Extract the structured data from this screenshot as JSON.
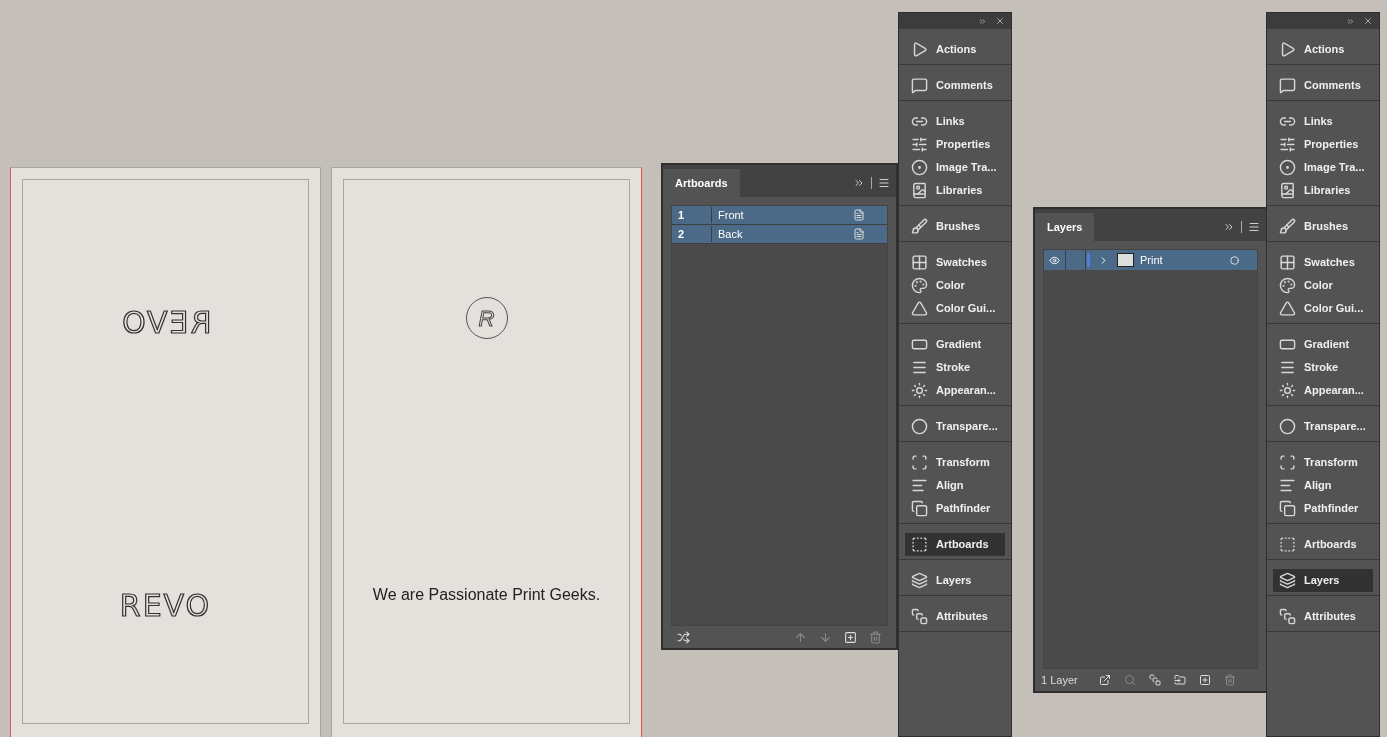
{
  "artboards_canvas": [
    {
      "kind": "logo_mirrored",
      "text": "REVO",
      "text2": "REVO"
    },
    {
      "kind": "tagline",
      "text": "We are Passionate Print Geeks.",
      "logo": "R"
    }
  ],
  "artboards_panel": {
    "tab": "Artboards",
    "rows": [
      {
        "number": "1",
        "name": "Front",
        "selected": true
      },
      {
        "number": "2",
        "name": "Back",
        "selected": true
      }
    ]
  },
  "layers_panel": {
    "tab": "Layers",
    "layers": [
      {
        "name": "Print",
        "visible": true,
        "selected": true
      }
    ],
    "footer": "1 Layer"
  },
  "docks": [
    {
      "groups": [
        [
          {
            "label": "Actions",
            "selected": false
          }
        ],
        [
          {
            "label": "Comments",
            "selected": false
          }
        ],
        [
          {
            "label": "Links",
            "selected": false
          },
          {
            "label": "Properties",
            "selected": false
          },
          {
            "label": "Image Tra...",
            "selected": false
          },
          {
            "label": "Libraries",
            "selected": false
          }
        ],
        [
          {
            "label": "Brushes",
            "selected": false
          }
        ],
        [
          {
            "label": "Swatches",
            "selected": false
          },
          {
            "label": "Color",
            "selected": false
          },
          {
            "label": "Color Gui...",
            "selected": false
          }
        ],
        [
          {
            "label": "Gradient",
            "selected": false
          },
          {
            "label": "Stroke",
            "selected": false
          },
          {
            "label": "Appearan...",
            "selected": false
          }
        ],
        [
          {
            "label": "Transpare...",
            "selected": false
          }
        ],
        [
          {
            "label": "Transform",
            "selected": false
          },
          {
            "label": "Align",
            "selected": false
          },
          {
            "label": "Pathfinder",
            "selected": false
          }
        ],
        [
          {
            "label": "Artboards",
            "selected": true
          }
        ],
        [
          {
            "label": "Layers",
            "selected": false
          }
        ],
        [
          {
            "label": "Attributes",
            "selected": false
          }
        ]
      ]
    },
    {
      "groups": [
        [
          {
            "label": "Actions",
            "selected": false
          }
        ],
        [
          {
            "label": "Comments",
            "selected": false
          }
        ],
        [
          {
            "label": "Links",
            "selected": false
          },
          {
            "label": "Properties",
            "selected": false
          },
          {
            "label": "Image Tra...",
            "selected": false
          },
          {
            "label": "Libraries",
            "selected": false
          }
        ],
        [
          {
            "label": "Brushes",
            "selected": false
          }
        ],
        [
          {
            "label": "Swatches",
            "selected": false
          },
          {
            "label": "Color",
            "selected": false
          },
          {
            "label": "Color Gui...",
            "selected": false
          }
        ],
        [
          {
            "label": "Gradient",
            "selected": false
          },
          {
            "label": "Stroke",
            "selected": false
          },
          {
            "label": "Appearan...",
            "selected": false
          }
        ],
        [
          {
            "label": "Transpare...",
            "selected": false
          }
        ],
        [
          {
            "label": "Transform",
            "selected": false
          },
          {
            "label": "Align",
            "selected": false
          },
          {
            "label": "Pathfinder",
            "selected": false
          }
        ],
        [
          {
            "label": "Artboards",
            "selected": false
          }
        ],
        [
          {
            "label": "Layers",
            "selected": true
          }
        ],
        [
          {
            "label": "Attributes",
            "selected": false
          }
        ]
      ]
    }
  ]
}
